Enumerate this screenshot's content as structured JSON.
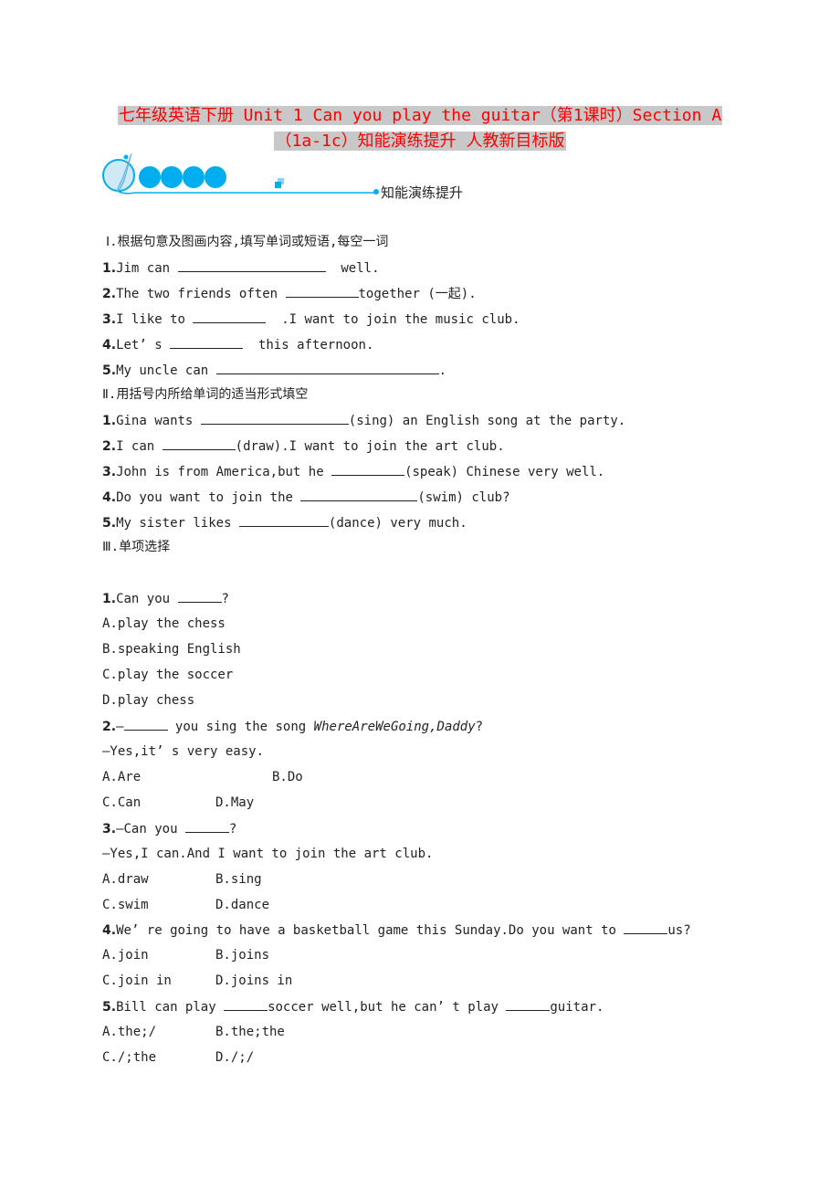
{
  "title": {
    "line1": "七年级英语下册 Unit 1 Can you play the guitar（第1课时）Section A",
    "line2": "（1a-1c）知能演练提升 人教新目标版",
    "color": "#ff0000",
    "highlight": "#c8c8c8"
  },
  "banner": {
    "icon": "paintbrush-icon",
    "label": "知能演练提升",
    "accent": "#00aeef"
  },
  "section1": {
    "heading": "Ⅰ.根据句意及图画内容,填写单词或短语,每空一词",
    "items": [
      {
        "num": "1.",
        "before": "Jim can ",
        "after": "  well."
      },
      {
        "num": "2.",
        "before": "The two friends often ",
        "after": "together (一起)."
      },
      {
        "num": "3.",
        "before": "I like to ",
        "after": "  .I want to join the music club."
      },
      {
        "num": "4.",
        "before": "Let’ s ",
        "after": "  this afternoon."
      },
      {
        "num": "5.",
        "before": "My uncle can ",
        "after": "."
      }
    ]
  },
  "section2": {
    "heading": "Ⅱ.用括号内所给单词的适当形式填空",
    "items": [
      {
        "num": "1.",
        "before": "Gina wants ",
        "after": "(sing) an English song at the party."
      },
      {
        "num": "2.",
        "before": "I can ",
        "after": "(draw).I want to join the art club."
      },
      {
        "num": "3.",
        "before": "John is from America,but he ",
        "after": "(speak) Chinese very well."
      },
      {
        "num": "4.",
        "before": "Do you want to join the ",
        "after": "(swim) club?"
      },
      {
        "num": "5.",
        "before": "My sister likes ",
        "after": "(dance) very much."
      }
    ]
  },
  "section3": {
    "heading": "Ⅲ.单项选择",
    "q1": {
      "num": "1.",
      "stem_before": "Can you ",
      "stem_after": "?",
      "options": [
        "A.play the chess",
        "B.speaking English",
        "C.play the soccer",
        "D.play chess"
      ]
    },
    "q2": {
      "num": "2.",
      "stem_before": "—",
      "stem_mid": " you sing the song ",
      "stem_italic": "WhereAreWeGoing,Daddy",
      "stem_after": "?",
      "answer": "—Yes,it’ s very easy.",
      "options": [
        "A.Are",
        "B.Do",
        "C.Can",
        "D.May"
      ]
    },
    "q3": {
      "num": "3.",
      "stem_before": "—Can you ",
      "stem_after": "?",
      "answer": "—Yes,I can.And I want to join the art club.",
      "options": [
        "A.draw",
        "B.sing",
        "C.swim",
        "D.dance"
      ]
    },
    "q4": {
      "num": "4.",
      "stem_before": "We’ re going to have a basketball game this Sunday.Do you want to ",
      "stem_after": "us?",
      "options": [
        "A.join",
        "B.joins",
        "C.join in",
        "D.joins in"
      ]
    },
    "q5": {
      "num": "5.",
      "stem_before": "Bill can play ",
      "stem_mid": "soccer well,but he can’ t play ",
      "stem_after": "guitar.",
      "options": [
        "A.the;/",
        "B.the;the",
        "C./;the",
        "D./;/"
      ]
    }
  }
}
